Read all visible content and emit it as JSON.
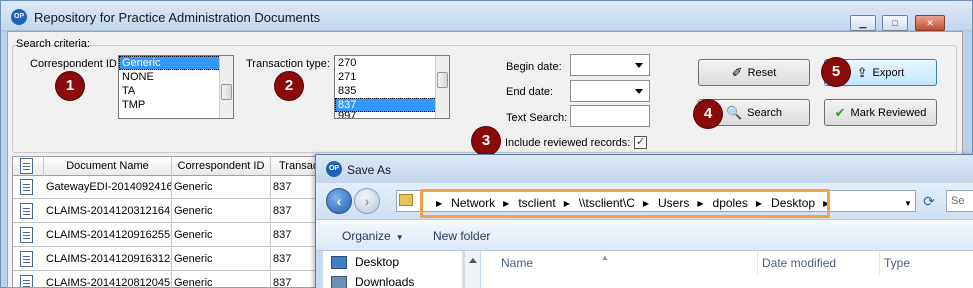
{
  "main_window": {
    "title": "Repository for Practice Administration Documents",
    "title_buttons": {
      "minimize": "▁",
      "maximize": "□",
      "close": "✕"
    }
  },
  "criteria": {
    "group_label": "Search criteria:",
    "correspondent_label": "Correspondent ID:",
    "correspondent_options": [
      "Generic",
      "NONE",
      "TA",
      "TMP"
    ],
    "correspondent_selected": "Generic",
    "transaction_label": "Transaction type:",
    "transaction_options": [
      "270",
      "271",
      "835",
      "837",
      "997"
    ],
    "transaction_selected": "837",
    "begin_date_label": "Begin date:",
    "end_date_label": "End date:",
    "text_search_label": "Text Search:",
    "include_reviewed_label": "Include reviewed records:",
    "include_reviewed_checked": true
  },
  "buttons": {
    "reset": "Reset",
    "export": "Export",
    "search": "Search",
    "mark_reviewed": "Mark Reviewed"
  },
  "badges": [
    "1",
    "2",
    "3",
    "4",
    "5"
  ],
  "grid": {
    "columns": [
      "Document Name",
      "Correspondent ID",
      "Transac"
    ],
    "rows": [
      {
        "name": "GatewayEDI-2014092416",
        "corr": "Generic",
        "type": "837"
      },
      {
        "name": "CLAIMS-2014120312164",
        "corr": "Generic",
        "type": "837"
      },
      {
        "name": "CLAIMS-2014120916255",
        "corr": "Generic",
        "type": "837"
      },
      {
        "name": "CLAIMS-2014120916312",
        "corr": "Generic",
        "type": "837"
      },
      {
        "name": "CLAIMS-2014120812045",
        "corr": "Generic",
        "type": "837"
      }
    ]
  },
  "save_dialog": {
    "title": "Save As",
    "breadcrumbs": [
      "Network",
      "tsclient",
      "\\\\tsclient\\C",
      "Users",
      "dpoles",
      "Desktop"
    ],
    "search_placeholder": "Se",
    "toolbar": {
      "organize": "Organize",
      "new_folder": "New folder"
    },
    "nav_items": [
      "Desktop",
      "Downloads"
    ],
    "columns": {
      "name": "Name",
      "date": "Date modified",
      "type": "Type"
    }
  },
  "colors": {
    "badge": "#8b0a0a",
    "highlight": "#f5a04a",
    "selection": "#3399ff"
  }
}
